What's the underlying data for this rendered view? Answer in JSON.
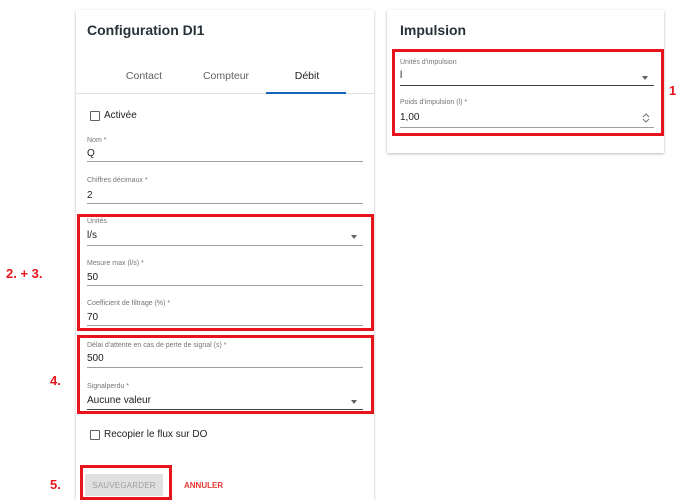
{
  "left_card": {
    "title": "Configuration DI1",
    "tabs": [
      {
        "label": "Contact",
        "active": false
      },
      {
        "label": "Compteur",
        "active": false
      },
      {
        "label": "Débit",
        "active": true
      }
    ],
    "activated_label": "Activée",
    "fields": {
      "nom": {
        "label": "Nom *",
        "value": "Q"
      },
      "decimales": {
        "label": "Chiffres décimaux *",
        "value": "2"
      },
      "unites": {
        "label": "Unités",
        "value": "l/s"
      },
      "mesure_max": {
        "label": "Mesure max (l/s) *",
        "value": "50"
      },
      "filtrage": {
        "label": "Coefficient de filtrage (%) *",
        "value": "70"
      },
      "delai": {
        "label": "Délai d'attente en cas de perte de signal (s) *",
        "value": "500"
      },
      "signal_perdu": {
        "label": "Signalperdu *",
        "value": "Aucune valeur"
      }
    },
    "copy_flow_label": "Recopier le flux sur DO",
    "save_label": "SAUVEGARDER",
    "cancel_label": "ANNULER"
  },
  "right_card": {
    "title": "Impulsion",
    "fields": {
      "unites_impulsion": {
        "label": "Unités d'impulsion",
        "value": "l"
      },
      "poids_impulsion": {
        "label": "Poids d'impulsion (l) *",
        "value": "1,00"
      }
    }
  },
  "annotations": {
    "a1": "1",
    "a23": "2. + 3.",
    "a4": "4.",
    "a5": "5."
  },
  "colors": {
    "annotation_red": "#e8141c",
    "tab_indicator": "#1565c0",
    "cancel_red": "#e53935"
  }
}
